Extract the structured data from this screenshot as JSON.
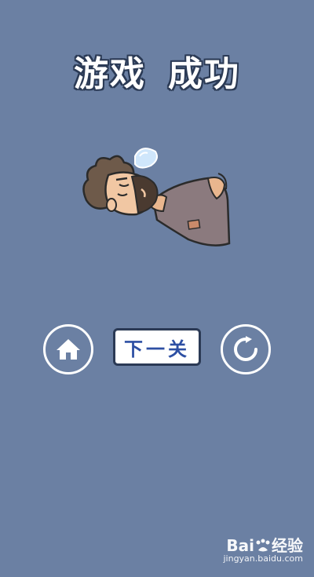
{
  "title": {
    "part1": "游戏",
    "part2": "成功"
  },
  "buttons": {
    "home_icon": "home-icon",
    "next_label": "下一关",
    "retry_icon": "refresh-icon"
  },
  "watermark": {
    "main_prefix": "Bai",
    "main_suffix": "经验",
    "url": "jingyan.baidu.com"
  },
  "colors": {
    "background": "#6b80a3",
    "title_text": "#ffffff",
    "button_text": "#2d4fa3"
  }
}
